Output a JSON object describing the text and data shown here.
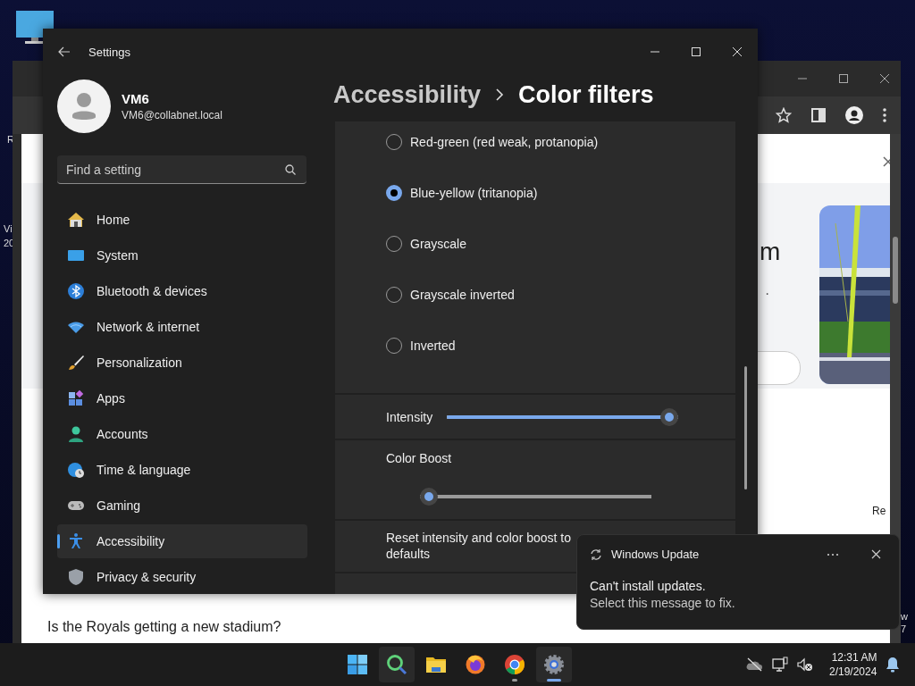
{
  "desktop": {
    "fragments": [
      "R",
      "Vi",
      "20",
      "w",
      "7"
    ]
  },
  "browser": {
    "fragments": [
      "m",
      "·",
      "Re"
    ],
    "question": "Is the Royals getting a new stadium?"
  },
  "settings": {
    "title": "Settings",
    "user": {
      "name": "VM6",
      "email": "VM6@collabnet.local"
    },
    "search": {
      "placeholder": "Find a setting"
    },
    "nav": [
      {
        "label": "Home",
        "selected": false
      },
      {
        "label": "System",
        "selected": false
      },
      {
        "label": "Bluetooth & devices",
        "selected": false
      },
      {
        "label": "Network & internet",
        "selected": false
      },
      {
        "label": "Personalization",
        "selected": false
      },
      {
        "label": "Apps",
        "selected": false
      },
      {
        "label": "Accounts",
        "selected": false
      },
      {
        "label": "Time & language",
        "selected": false
      },
      {
        "label": "Gaming",
        "selected": false
      },
      {
        "label": "Accessibility",
        "selected": true
      },
      {
        "label": "Privacy & security",
        "selected": false
      }
    ],
    "breadcrumb": [
      "Accessibility",
      "Color filters"
    ],
    "filters": [
      {
        "label": "Red-green (red weak, protanopia)",
        "selected": false
      },
      {
        "label": "Blue-yellow (tritanopia)",
        "selected": true
      },
      {
        "label": "Grayscale",
        "selected": false
      },
      {
        "label": "Grayscale inverted",
        "selected": false
      },
      {
        "label": "Inverted",
        "selected": false
      }
    ],
    "sliders": [
      {
        "kind": "inline",
        "label": "Intensity",
        "level": 1.0
      },
      {
        "kind": "stacked",
        "label": "Color Boost",
        "level": 0.0
      }
    ],
    "reset_label": "Reset intensity and color boost to defaults"
  },
  "notification": {
    "app": "Windows Update",
    "title": "Can't install updates.",
    "message": "Select this message to fix."
  },
  "taskbar": {
    "apps": [
      {
        "highlighted": false,
        "running": false,
        "active": false
      },
      {
        "highlighted": true,
        "running": false,
        "active": false
      },
      {
        "highlighted": false,
        "running": false,
        "active": false
      },
      {
        "highlighted": false,
        "running": false,
        "active": false
      },
      {
        "highlighted": false,
        "running": true,
        "active": false
      },
      {
        "highlighted": true,
        "running": true,
        "active": true
      }
    ],
    "time": "12:31 AM",
    "date": "2/19/2024"
  }
}
